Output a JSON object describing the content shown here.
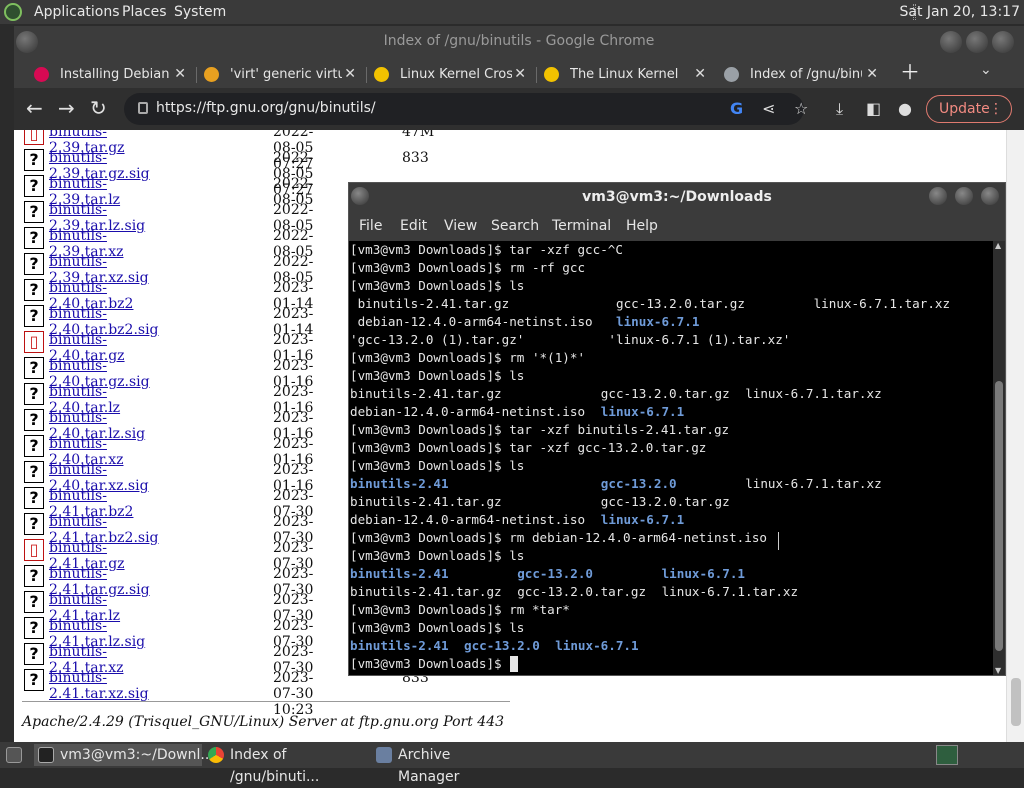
{
  "top_panel": {
    "menus": [
      "Applications",
      "Places",
      "System"
    ],
    "clock": "Sat Jan 20, 13:17"
  },
  "chrome": {
    "title": "Index of /gnu/binutils - Google Chrome",
    "tabs": [
      {
        "label": "Installing Debian v",
        "icon": "debian-icon",
        "color": "#d70a53"
      },
      {
        "label": "'virt' generic virtual",
        "icon": "qemu-icon",
        "color": "#e8a020"
      },
      {
        "label": "Linux Kernel Cross",
        "icon": "tux-icon",
        "color": "#f2c200"
      },
      {
        "label": "The Linux Kernel A",
        "icon": "tux-icon",
        "color": "#f2c200"
      },
      {
        "label": "Index of /gnu/binut",
        "icon": "globe-icon",
        "color": "#9aa0a6"
      }
    ],
    "url": "https://ftp.gnu.org/gnu/binutils/",
    "update_label": "Update"
  },
  "listing": {
    "files": [
      {
        "name": "binutils-2.39.tar.gz",
        "date": "2022-08-05 07:27",
        "size": "47M",
        "type": "pkg"
      },
      {
        "name": "binutils-2.39.tar.gz.sig",
        "date": "2022-08-05 07:27",
        "size": "833",
        "type": "unknown"
      },
      {
        "name": "binutils-2.39.tar.lz",
        "date": "2022-08-05",
        "size": "",
        "type": "unknown"
      },
      {
        "name": "binutils-2.39.tar.lz.sig",
        "date": "2022-08-05",
        "size": "",
        "type": "unknown"
      },
      {
        "name": "binutils-2.39.tar.xz",
        "date": "2022-08-05",
        "size": "",
        "type": "unknown"
      },
      {
        "name": "binutils-2.39.tar.xz.sig",
        "date": "2022-08-05",
        "size": "",
        "type": "unknown"
      },
      {
        "name": "binutils-2.40.tar.bz2",
        "date": "2023-01-14",
        "size": "",
        "type": "unknown"
      },
      {
        "name": "binutils-2.40.tar.bz2.sig",
        "date": "2023-01-14",
        "size": "",
        "type": "unknown"
      },
      {
        "name": "binutils-2.40.tar.gz",
        "date": "2023-01-16",
        "size": "",
        "type": "pkg"
      },
      {
        "name": "binutils-2.40.tar.gz.sig",
        "date": "2023-01-16",
        "size": "",
        "type": "unknown"
      },
      {
        "name": "binutils-2.40.tar.lz",
        "date": "2023-01-16",
        "size": "",
        "type": "unknown"
      },
      {
        "name": "binutils-2.40.tar.lz.sig",
        "date": "2023-01-16",
        "size": "",
        "type": "unknown"
      },
      {
        "name": "binutils-2.40.tar.xz",
        "date": "2023-01-16",
        "size": "",
        "type": "unknown"
      },
      {
        "name": "binutils-2.40.tar.xz.sig",
        "date": "2023-01-16",
        "size": "",
        "type": "unknown"
      },
      {
        "name": "binutils-2.41.tar.bz2",
        "date": "2023-07-30",
        "size": "",
        "type": "unknown"
      },
      {
        "name": "binutils-2.41.tar.bz2.sig",
        "date": "2023-07-30",
        "size": "",
        "type": "unknown"
      },
      {
        "name": "binutils-2.41.tar.gz",
        "date": "2023-07-30",
        "size": "",
        "type": "pkg"
      },
      {
        "name": "binutils-2.41.tar.gz.sig",
        "date": "2023-07-30",
        "size": "",
        "type": "unknown"
      },
      {
        "name": "binutils-2.41.tar.lz",
        "date": "2023-07-30",
        "size": "",
        "type": "unknown"
      },
      {
        "name": "binutils-2.41.tar.lz.sig",
        "date": "2023-07-30",
        "size": "",
        "type": "unknown"
      },
      {
        "name": "binutils-2.41.tar.xz",
        "date": "2023-07-30",
        "size": "",
        "type": "unknown"
      },
      {
        "name": "binutils-2.41.tar.xz.sig",
        "date": "2023-07-30 10:23",
        "size": "833",
        "type": "unknown"
      }
    ],
    "server_signature": "Apache/2.4.29 (Trisquel_GNU/Linux) Server at ftp.gnu.org Port 443"
  },
  "terminal": {
    "title": "vm3@vm3:~/Downloads",
    "menu": [
      "File",
      "Edit",
      "View",
      "Search",
      "Terminal",
      "Help"
    ],
    "lines": [
      [
        {
          "t": "[vm3@vm3 Downloads]$ tar -xzf gcc-^C",
          "c": 0
        }
      ],
      [
        {
          "t": "[vm3@vm3 Downloads]$ rm -rf gcc",
          "c": 0
        }
      ],
      [
        {
          "t": "[vm3@vm3 Downloads]$ ls",
          "c": 0
        }
      ],
      [
        {
          "t": " binutils-2.41.tar.gz",
          "c": 0
        },
        {
          "t": "gcc-13.2.0.tar.gz",
          "c": 35
        },
        {
          "t": "linux-6.7.1.tar.xz",
          "c": 61
        }
      ],
      [
        {
          "t": " debian-12.4.0-arm64-netinst.iso",
          "c": 0
        },
        {
          "t": "linux-6.7.1",
          "c": 35,
          "dir": true
        }
      ],
      [
        {
          "t": "'gcc-13.2.0 (1).tar.gz'",
          "c": 0
        },
        {
          "t": "'linux-6.7.1 (1).tar.xz'",
          "c": 34
        }
      ],
      [
        {
          "t": "[vm3@vm3 Downloads]$ rm '*(1)*'",
          "c": 0
        }
      ],
      [
        {
          "t": "[vm3@vm3 Downloads]$ ls",
          "c": 0
        }
      ],
      [
        {
          "t": "binutils-2.41.tar.gz",
          "c": 0
        },
        {
          "t": "gcc-13.2.0.tar.gz",
          "c": 33
        },
        {
          "t": "linux-6.7.1.tar.xz",
          "c": 52
        }
      ],
      [
        {
          "t": "debian-12.4.0-arm64-netinst.iso",
          "c": 0
        },
        {
          "t": "linux-6.7.1",
          "c": 33,
          "dir": true
        }
      ],
      [
        {
          "t": "[vm3@vm3 Downloads]$ tar -xzf binutils-2.41.tar.gz",
          "c": 0
        }
      ],
      [
        {
          "t": "[vm3@vm3 Downloads]$ tar -xzf gcc-13.2.0.tar.gz",
          "c": 0
        }
      ],
      [
        {
          "t": "[vm3@vm3 Downloads]$ ls",
          "c": 0
        }
      ],
      [
        {
          "t": "binutils-2.41",
          "c": 0,
          "dir": true
        },
        {
          "t": "gcc-13.2.0",
          "c": 33,
          "dir": true
        },
        {
          "t": "linux-6.7.1.tar.xz",
          "c": 52
        }
      ],
      [
        {
          "t": "binutils-2.41.tar.gz",
          "c": 0
        },
        {
          "t": "gcc-13.2.0.tar.gz",
          "c": 33
        }
      ],
      [
        {
          "t": "debian-12.4.0-arm64-netinst.iso",
          "c": 0
        },
        {
          "t": "linux-6.7.1",
          "c": 33,
          "dir": true
        }
      ],
      [
        {
          "t": "[vm3@vm3 Downloads]$ rm debian-12.4.0-arm64-netinst.iso",
          "c": 0
        }
      ],
      [
        {
          "t": "[vm3@vm3 Downloads]$ ls",
          "c": 0
        }
      ],
      [
        {
          "t": "binutils-2.41",
          "c": 0,
          "dir": true
        },
        {
          "t": "gcc-13.2.0",
          "c": 22,
          "dir": true
        },
        {
          "t": "linux-6.7.1",
          "c": 41,
          "dir": true
        }
      ],
      [
        {
          "t": "binutils-2.41.tar.gz",
          "c": 0
        },
        {
          "t": "gcc-13.2.0.tar.gz",
          "c": 22
        },
        {
          "t": "linux-6.7.1.tar.xz",
          "c": 41
        }
      ],
      [
        {
          "t": "[vm3@vm3 Downloads]$ rm *tar*",
          "c": 0
        }
      ],
      [
        {
          "t": "[vm3@vm3 Downloads]$ ls",
          "c": 0
        }
      ],
      [
        {
          "t": "binutils-2.41",
          "c": 0,
          "dir": true
        },
        {
          "t": "gcc-13.2.0",
          "c": 15,
          "dir": true
        },
        {
          "t": "linux-6.7.1",
          "c": 27,
          "dir": true
        }
      ],
      [
        {
          "t": "[vm3@vm3 Downloads]$ ",
          "c": 0
        }
      ]
    ]
  },
  "taskbar": {
    "items": [
      {
        "label": "vm3@vm3:~/Downl...",
        "icon": "terminal-icon"
      },
      {
        "label": "Index of /gnu/binuti...",
        "icon": "chrome-icon"
      },
      {
        "label": "Archive Manager",
        "icon": "archive-icon"
      }
    ]
  }
}
